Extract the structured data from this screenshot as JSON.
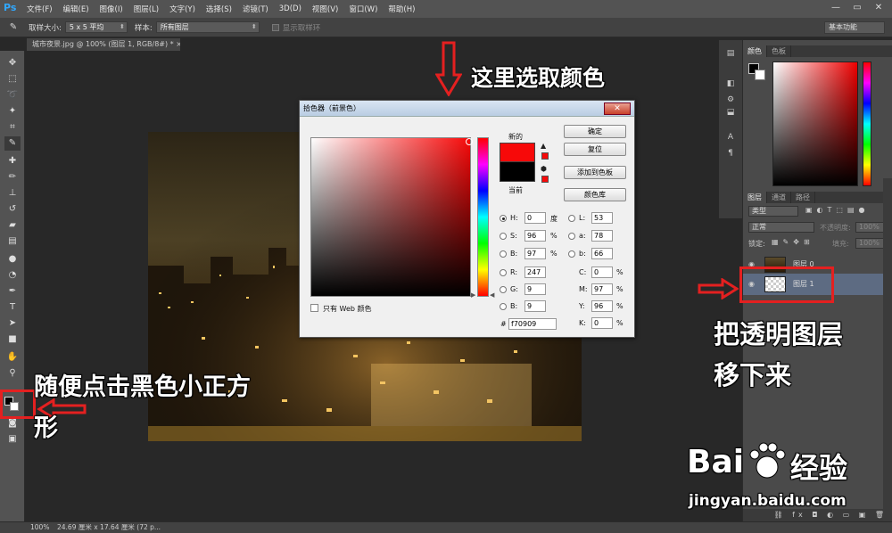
{
  "menubar": {
    "logo": "Ps",
    "items": [
      "文件(F)",
      "编辑(E)",
      "图像(I)",
      "图层(L)",
      "文字(Y)",
      "选择(S)",
      "滤镜(T)",
      "3D(D)",
      "视图(V)",
      "窗口(W)",
      "帮助(H)"
    ],
    "window_controls": [
      "—",
      "▭",
      "✕"
    ]
  },
  "optbar": {
    "sample_size_label": "取样大小:",
    "sample_size_value": "5 x 5 平均",
    "sample_label": "样本:",
    "sample_value": "所有图层",
    "show_ring_label": "显示取样环",
    "workspace": "基本功能"
  },
  "doc_tab": "城市夜景.jpg @ 100% (图层 1, RGB/8#) *  ×",
  "picker": {
    "title": "拾色器（前景色）",
    "close": "✕",
    "new_label": "新的",
    "current_label": "当前",
    "ok": "确定",
    "reset": "复位",
    "add_swatch": "添加到色板",
    "color_libraries": "颜色库",
    "web_only": "只有 Web 颜色",
    "fields": {
      "H": {
        "label": "H:",
        "value": "0",
        "unit": "度"
      },
      "S": {
        "label": "S:",
        "value": "96",
        "unit": "%"
      },
      "Bv": {
        "label": "B:",
        "value": "97",
        "unit": "%"
      },
      "R": {
        "label": "R:",
        "value": "247"
      },
      "G": {
        "label": "G:",
        "value": "9"
      },
      "Bc": {
        "label": "B:",
        "value": "9"
      },
      "L": {
        "label": "L:",
        "value": "53"
      },
      "a": {
        "label": "a:",
        "value": "78"
      },
      "b": {
        "label": "b:",
        "value": "66"
      },
      "C": {
        "label": "C:",
        "value": "0",
        "unit": "%"
      },
      "M": {
        "label": "M:",
        "value": "97",
        "unit": "%"
      },
      "Y": {
        "label": "Y:",
        "value": "96",
        "unit": "%"
      },
      "K": {
        "label": "K:",
        "value": "0",
        "unit": "%"
      },
      "hash": "#",
      "hex": "f70909"
    },
    "new_color": "#f70909",
    "current_color": "#000000"
  },
  "color_panel": {
    "tabs": [
      "颜色",
      "色板"
    ]
  },
  "layers_panel": {
    "tabs": [
      "图层",
      "通道",
      "路径"
    ],
    "kind_select": "类型",
    "blend_mode": "正常",
    "opacity_label": "不透明度:",
    "opacity_value": "100%",
    "lock_label": "锁定:",
    "fill_label": "填充:",
    "fill_value": "100%",
    "layers": [
      {
        "name": "图层 0"
      },
      {
        "name": "图层 1"
      }
    ],
    "bottom_icons": "⛓ fx ◘ ◐ ▭ ▣ 🗑"
  },
  "statusbar": {
    "zoom": "100%",
    "doc_info": "24.69 厘米 x 17.64 厘米 (72 p..."
  },
  "annotations": {
    "pick_color": "这里选取颜色",
    "click_square_line1": "随便点击黑色小正方",
    "click_square_line2": "形",
    "move_layer_line1": "把透明图层",
    "move_layer_line2": "移下来"
  },
  "watermark": {
    "brand_left": "Bai",
    "brand_right": "经验",
    "url": "jingyan.baidu.com"
  },
  "colors": {
    "annotation_red": "#e42020",
    "selected_color": "#f70909",
    "ps_blue": "#31a8ff"
  }
}
